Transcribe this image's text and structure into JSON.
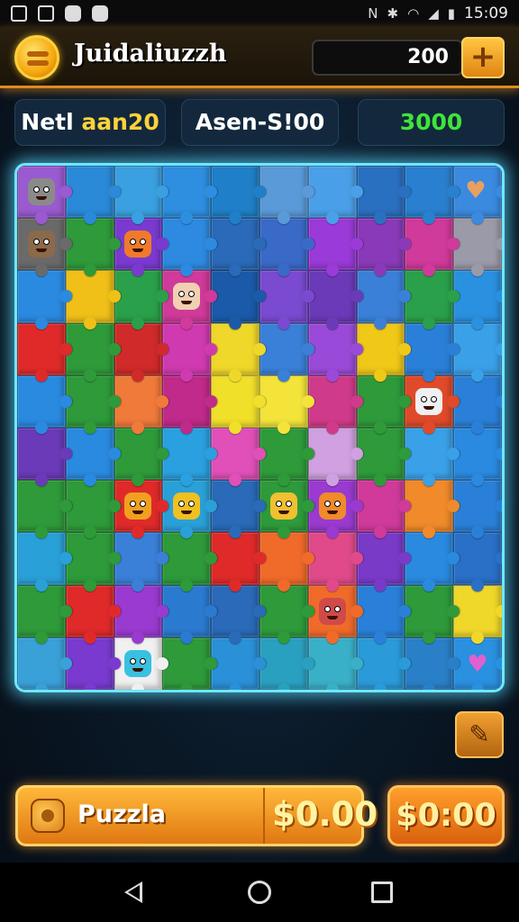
{
  "status_bar": {
    "time": "15:09",
    "icons": [
      "gallery-icon",
      "image-icon",
      "instagram-icon",
      "chat-icon",
      "nfc-icon",
      "bluetooth-icon",
      "wifi-icon",
      "signal-icon",
      "battery-icon"
    ]
  },
  "header": {
    "title": "Juidaliuzzh",
    "balance": "200",
    "add_label": "+"
  },
  "stats": [
    {
      "part1": "Netl ",
      "part2": "aan20"
    },
    {
      "label": "Asen-S!00"
    },
    {
      "label": "3000"
    }
  ],
  "board": {
    "rows": 10,
    "cols": 10,
    "glow_color": "#6ee8ff"
  },
  "edit_label": "✎",
  "bottom": {
    "puzzle_label": "Puzzla",
    "puzzle_price": "$0.00",
    "buy_price": "$0:00"
  },
  "colors": {
    "accent": "#ffb83a",
    "stat_green": "#3fe43a",
    "stat_gold": "#ffd23a"
  }
}
